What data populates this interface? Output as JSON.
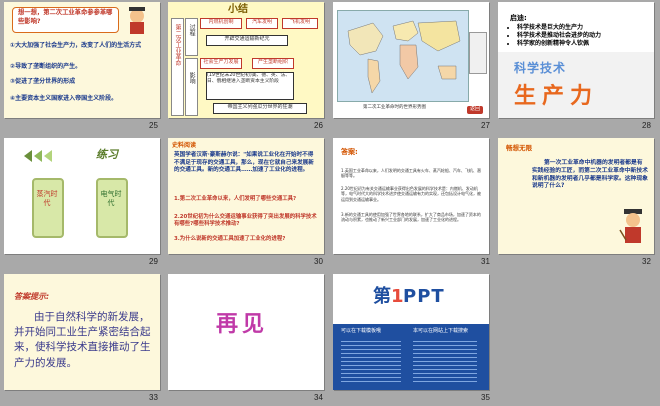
{
  "slides": [
    {
      "number": "25",
      "title": "想一想，第二次工业革命参参革哪些影响?",
      "items": [
        "①大大加强了社会生产力，改变了人们的生活方式",
        "②导致了垄断组织的产生。",
        "③促进了垄分世界的形成",
        "④主要资本主义国家进入帝国主义阶段。"
      ]
    },
    {
      "number": "26",
      "heading": "小结",
      "side_labels": [
        "第二次工业革命",
        "过程",
        "影响"
      ],
      "boxes": [
        "内燃机创制",
        "汽车发明",
        "飞机发明",
        "开辟交通运输新纪元",
        "社会生产力发展",
        "产生垄断组织",
        "(19世纪末20世纪初)美、德、英、法、日、俄相继进入垄断资本主义阶段",
        "帝国主义列强瓜分世界的狂潮"
      ]
    },
    {
      "number": "27",
      "caption": "第二次工业革命时的世界形势图",
      "btn": "返回"
    },
    {
      "number": "28",
      "title": "启迪:",
      "items": [
        "科学技术是巨大的生产力",
        "科学技术是推动社会进步的动力",
        "科学家的创新精神令人钦佩"
      ],
      "word1": "科学技术",
      "word2": "生产力"
    },
    {
      "number": "29",
      "heading": "练习",
      "cards": [
        "蒸汽时代",
        "电气时代"
      ]
    },
    {
      "number": "30",
      "label": "史料阅读",
      "quote": "英国学者汉斯·豪斯赫尔说：\"如果说工业化在开始时不得不满足于现存的交通工具，那么，现在它就自己来发展新的交通工具。新的交通工具……加速了工业化的进程。",
      "questions": [
        "1.第二次工业革命以来，人们发明了哪些交通工具?",
        "2.20世纪初为什么交通运输事业获得了突出发展的科学技术有哪些?哪些科学技术推动?",
        "3.为什么说新的交通工具加速了工业化的进程?"
      ]
    },
    {
      "number": "31",
      "label": "答案:",
      "paras": [
        "1.英国工业革命以来，人们发明的交通工具有火车、蒸汽轮船、汽车、飞机、潜艇等等。",
        "2.20世纪初为有关交通运输事业获得出色发展的科学技术是：内燃机、发动机等，电气时代大的科学技术进步使交通运输有力的实现，还包括设计电气化，被运用到交通运输事业。",
        "3.新的交通工具的使用加强了世界各地的联系，扩大了商品市场，加速了资本的流动与积累，也推动了新兴工业部门的发展，加速了工业化的进程。"
      ]
    },
    {
      "number": "32",
      "label": "畅想无限",
      "body": "第一次工业革命中机器的发明者都是有实践经验的工匠，而第二次工业革命中新技术和新机器的发明者几乎都是科学家。这种现象说明了什么?"
    },
    {
      "number": "33",
      "label": "答案提示:",
      "body": "由于自然科学的新发展，并开始同工业生产紧密结合起来，使科学技术直接推动了生产力的发展。"
    },
    {
      "number": "34",
      "text": "再见"
    },
    {
      "number": "35",
      "logo_a": "第",
      "logo_b": "1",
      "logo_c": "PPT",
      "col1": "可以在下载模板哦",
      "col2": "本可以在网站上下载搜索"
    }
  ]
}
